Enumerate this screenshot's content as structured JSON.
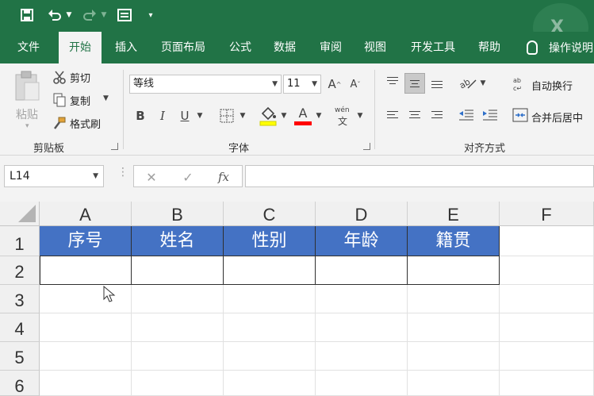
{
  "quick_access": {
    "save_icon": "save-icon",
    "undo_icon": "undo-icon",
    "redo_icon": "redo-icon",
    "form_icon": "form-icon",
    "customize_icon": "customize-icon"
  },
  "tabs": [
    "文件",
    "开始",
    "插入",
    "页面布局",
    "公式",
    "数据",
    "审阅",
    "视图",
    "开发工具",
    "帮助"
  ],
  "active_tab": "开始",
  "tell_me": "操作说明",
  "ribbon": {
    "clipboard": {
      "paste": "粘贴",
      "cut": "剪切",
      "copy": "复制",
      "format_painter": "格式刷",
      "group_label": "剪贴板"
    },
    "font": {
      "font_name": "等线",
      "font_size": "11",
      "grow_label": "A",
      "shrink_label": "A",
      "bold": "B",
      "italic": "I",
      "underline": "U",
      "font_color_label": "A",
      "phonetic_top": "wén",
      "phonetic_bottom": "文",
      "group_label": "字体"
    },
    "alignment": {
      "wrap_text": "自动换行",
      "merge_center": "合并后居中",
      "group_label": "对齐方式"
    }
  },
  "formula_bar": {
    "name_box": "L14",
    "cancel": "✕",
    "enter": "✓",
    "fx": "fx",
    "formula": ""
  },
  "sheet": {
    "columns": [
      "A",
      "B",
      "C",
      "D",
      "E",
      "F"
    ],
    "rows": [
      "1",
      "2",
      "3",
      "4",
      "5",
      "6"
    ],
    "headers": [
      "序号",
      "姓名",
      "性别",
      "年龄",
      "籍贯"
    ],
    "header_fill": "#4472c4"
  }
}
